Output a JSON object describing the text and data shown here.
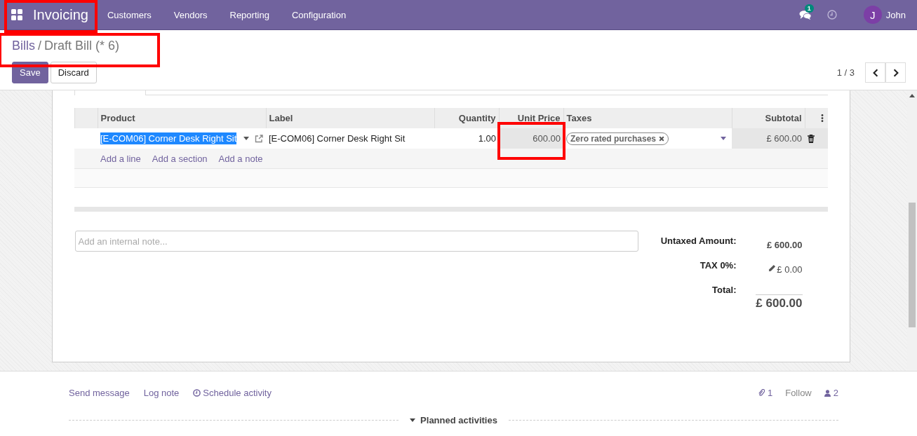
{
  "navbar": {
    "app": "Invoicing",
    "app_highlighted": true,
    "menu": [
      "Customers",
      "Vendors",
      "Reporting",
      "Configuration"
    ],
    "messages_badge": "1",
    "user_initial": "J",
    "user": "John"
  },
  "control_panel": {
    "breadcrumb_separator": "/",
    "breadcrumb": [
      {
        "label": "Bills"
      },
      {
        "label": "Draft Bill (* 6)"
      }
    ],
    "breadcrumb_highlighted": true,
    "buttons": [
      {
        "label": "Save",
        "kind": "primary"
      },
      {
        "label": "Discard",
        "kind": "secondary"
      }
    ],
    "pager": "1 / 3"
  },
  "lines": {
    "columns": [
      "Product",
      "Label",
      "Quantity",
      "Unit Price",
      "Taxes",
      "Subtotal"
    ],
    "rows": [
      {
        "product": "[E-COM06] Corner Desk Right Sit",
        "product_selected": true,
        "label": "[E-COM06] Corner Desk Right Sit",
        "quantity": "1.00",
        "unit_price": "600.00",
        "unit_price_highlighted": true,
        "tax_tags": [
          "Zero rated purchases"
        ],
        "subtotal": "£ 600.00"
      }
    ],
    "add_links": [
      "Add a line",
      "Add a section",
      "Add a note"
    ]
  },
  "note": {
    "placeholder": "Add an internal note..."
  },
  "totals": [
    {
      "label": "Untaxed Amount:",
      "value": "£ 600.00",
      "kind": "plain"
    },
    {
      "label": "TAX 0%:",
      "value": "£ 0.00",
      "kind": "editable"
    },
    {
      "label": "Total:",
      "value": "£ 600.00",
      "kind": "grand"
    }
  ],
  "chatter": {
    "actions": [
      {
        "label": "Send message",
        "kind": "text"
      },
      {
        "label": "Log note",
        "kind": "text"
      },
      {
        "label": "Schedule activity",
        "kind": "clock"
      }
    ],
    "attachments": "1",
    "follow": "Follow",
    "followers": "2",
    "planned": "Planned activities"
  }
}
